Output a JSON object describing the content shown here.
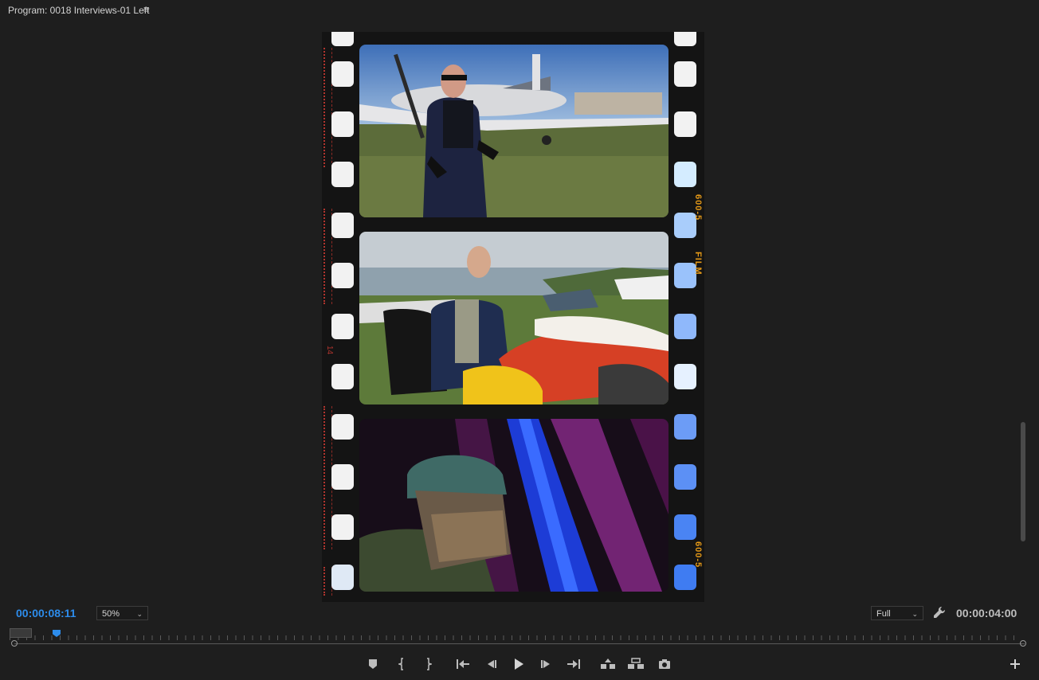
{
  "header": {
    "title": "Program: 0018 Interviews-01 Left",
    "menu_icon": "hamburger-menu-icon"
  },
  "viewer": {
    "film_edge_text_top": "600-5",
    "film_edge_text_mid": "FILM",
    "film_edge_text_bottom": "600-5",
    "film_edge_red_number": "14",
    "frames": [
      {
        "name": "interview-man-airplane"
      },
      {
        "name": "interview-man-parachutes"
      },
      {
        "name": "skydiver-helmet-colored-light"
      }
    ]
  },
  "controls": {
    "current_timecode": "00:00:08:11",
    "zoom": "50%",
    "quality": "Full",
    "duration_timecode": "00:00:04:00",
    "accent_color": "#2d8ceb",
    "icons": [
      "add-marker-icon",
      "mark-in-icon",
      "mark-out-icon",
      "go-to-in-icon",
      "step-back-icon",
      "play-icon",
      "step-forward-icon",
      "go-to-out-icon",
      "lift-icon",
      "extract-icon",
      "export-frame-icon",
      "add-button-icon",
      "wrench-icon"
    ]
  }
}
